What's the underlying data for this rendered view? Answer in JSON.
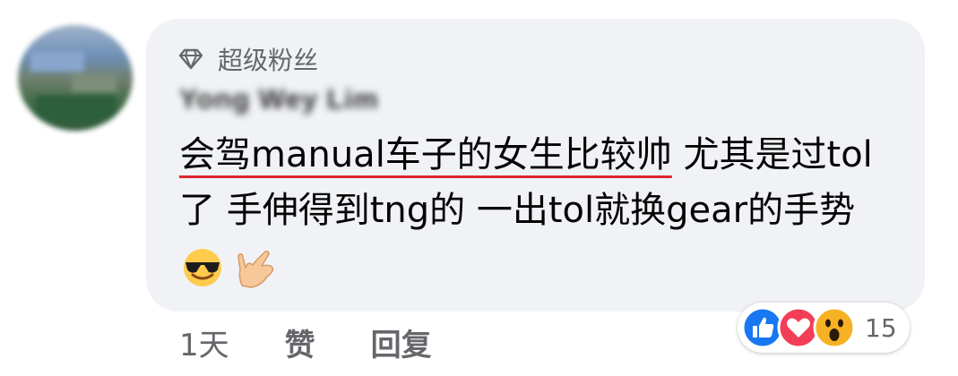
{
  "author": {
    "name": "Yong Wey Lim",
    "badge_label": "超级粉丝",
    "badge_icon": "diamond-icon"
  },
  "comment": {
    "underlined_text": "会驾manual车子的女生比较帅",
    "text_after": " 尤其是过tol了 手伸得到tng的 一出tol就换gear的手势 ",
    "emojis": [
      "smiling-face-with-sunglasses-icon",
      "love-you-gesture-icon"
    ],
    "underline_color": "#e0242c"
  },
  "actions": {
    "time": "1天",
    "like_label": "赞",
    "reply_label": "回复"
  },
  "reactions": {
    "icons": [
      "like-reaction-icon",
      "love-reaction-icon",
      "wow-reaction-icon"
    ],
    "count": "15"
  },
  "colors": {
    "bubble": "#f0f2f5",
    "secondary_text": "#65676b",
    "like_blue": "#1877f2",
    "love_red": "#f33e58"
  }
}
